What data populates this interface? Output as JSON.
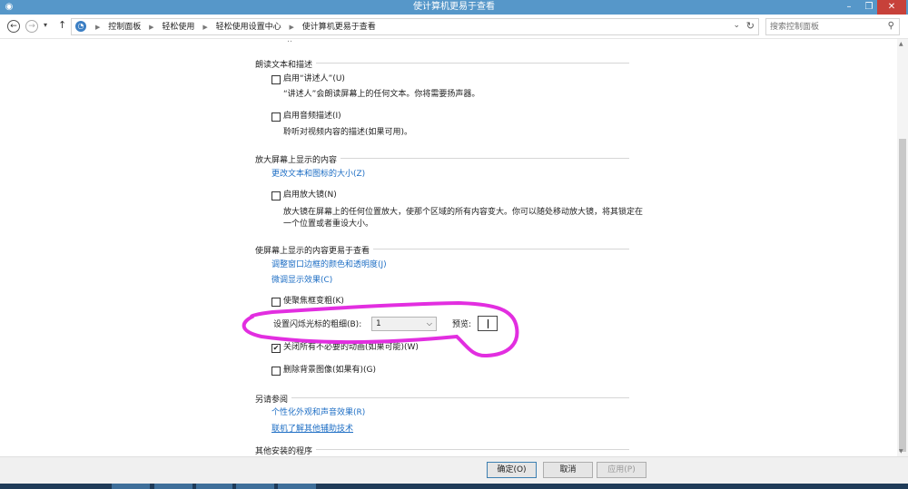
{
  "window": {
    "title": "使计算机更易于查看",
    "icon": "control-panel-icon"
  },
  "nav": {
    "breadcrumbs": [
      "控制面板",
      "轻松使用",
      "轻松使用设置中心",
      "使计算机更易于查看"
    ],
    "search_placeholder": "搜索控制面板"
  },
  "sections": {
    "narrator": {
      "heading": "朗读文本和描述",
      "narrator_label": "启用“讲述人”(U)",
      "narrator_checked": false,
      "narrator_desc": "“讲述人”会朗读屏幕上的任何文本。你将需要扬声器。",
      "audio_desc_label": "启用音频描述(I)",
      "audio_desc_checked": false,
      "audio_desc_desc": "聆听对视频内容的描述(如果可用)。"
    },
    "magnify": {
      "heading": "放大屏幕上显示的内容",
      "resize_link": "更改文本和图标的大小(Z)",
      "magnifier_label": "启用放大镜(N)",
      "magnifier_checked": false,
      "magnifier_desc_1": "放大镜在屏幕上的任何位置放大，使那个区域的所有内容变大。你可以随处移动放大镜，将其锁定在",
      "magnifier_desc_2": "一个位置或者重设大小。"
    },
    "easier": {
      "heading": "使屏幕上显示的内容更易于查看",
      "link_border": "调整窗口边框的颜色和透明度(J)",
      "link_cleartype": "微调显示效果(C)",
      "focus_label": "使聚焦框变粗(K)",
      "focus_checked": false,
      "cursor_label": "设置闪烁光标的粗细(B):",
      "cursor_value": "1",
      "preview_label": "预览:",
      "anim_label": "关闭所有不必要的动画(如果可能)(W)",
      "anim_checked": true,
      "bg_label": "删除背景图像(如果有)(G)",
      "bg_checked": false
    },
    "seealso": {
      "heading": "另请参阅",
      "link_personalize": "个性化外观和声音效果(R)",
      "link_assistive": "联机了解其他辅助技术"
    },
    "other": {
      "heading": "其他安装的程序"
    }
  },
  "footer": {
    "ok": "确定(O)",
    "cancel": "取消",
    "apply": "应用(P)"
  },
  "colors": {
    "titlebar": "#5697c9",
    "link": "#1f6fc5",
    "highlight": "#e22ee0",
    "close": "#c7413a"
  }
}
